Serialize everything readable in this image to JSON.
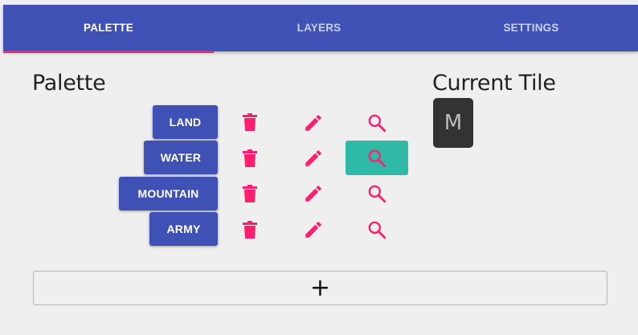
{
  "tabs": [
    {
      "label": "PALETTE",
      "active": true
    },
    {
      "label": "LAYERS",
      "active": false
    },
    {
      "label": "SETTINGS",
      "active": false
    }
  ],
  "palette": {
    "heading": "Palette",
    "items": [
      {
        "label": "LAND",
        "selected": false
      },
      {
        "label": "WATER",
        "selected": true
      },
      {
        "label": "MOUNTAIN",
        "selected": false
      },
      {
        "label": "ARMY",
        "selected": false
      }
    ],
    "add_label": "+"
  },
  "current_tile": {
    "heading": "Current Tile",
    "letter": "M"
  },
  "icons": {
    "delete": "trash-icon",
    "edit": "pencil-icon",
    "select": "search-icon",
    "add": "plus-icon"
  },
  "colors": {
    "primary": "#3f51b5",
    "accent": "#ff1e6e",
    "selected": "#2fbaa8",
    "tile_bg": "#333333"
  }
}
